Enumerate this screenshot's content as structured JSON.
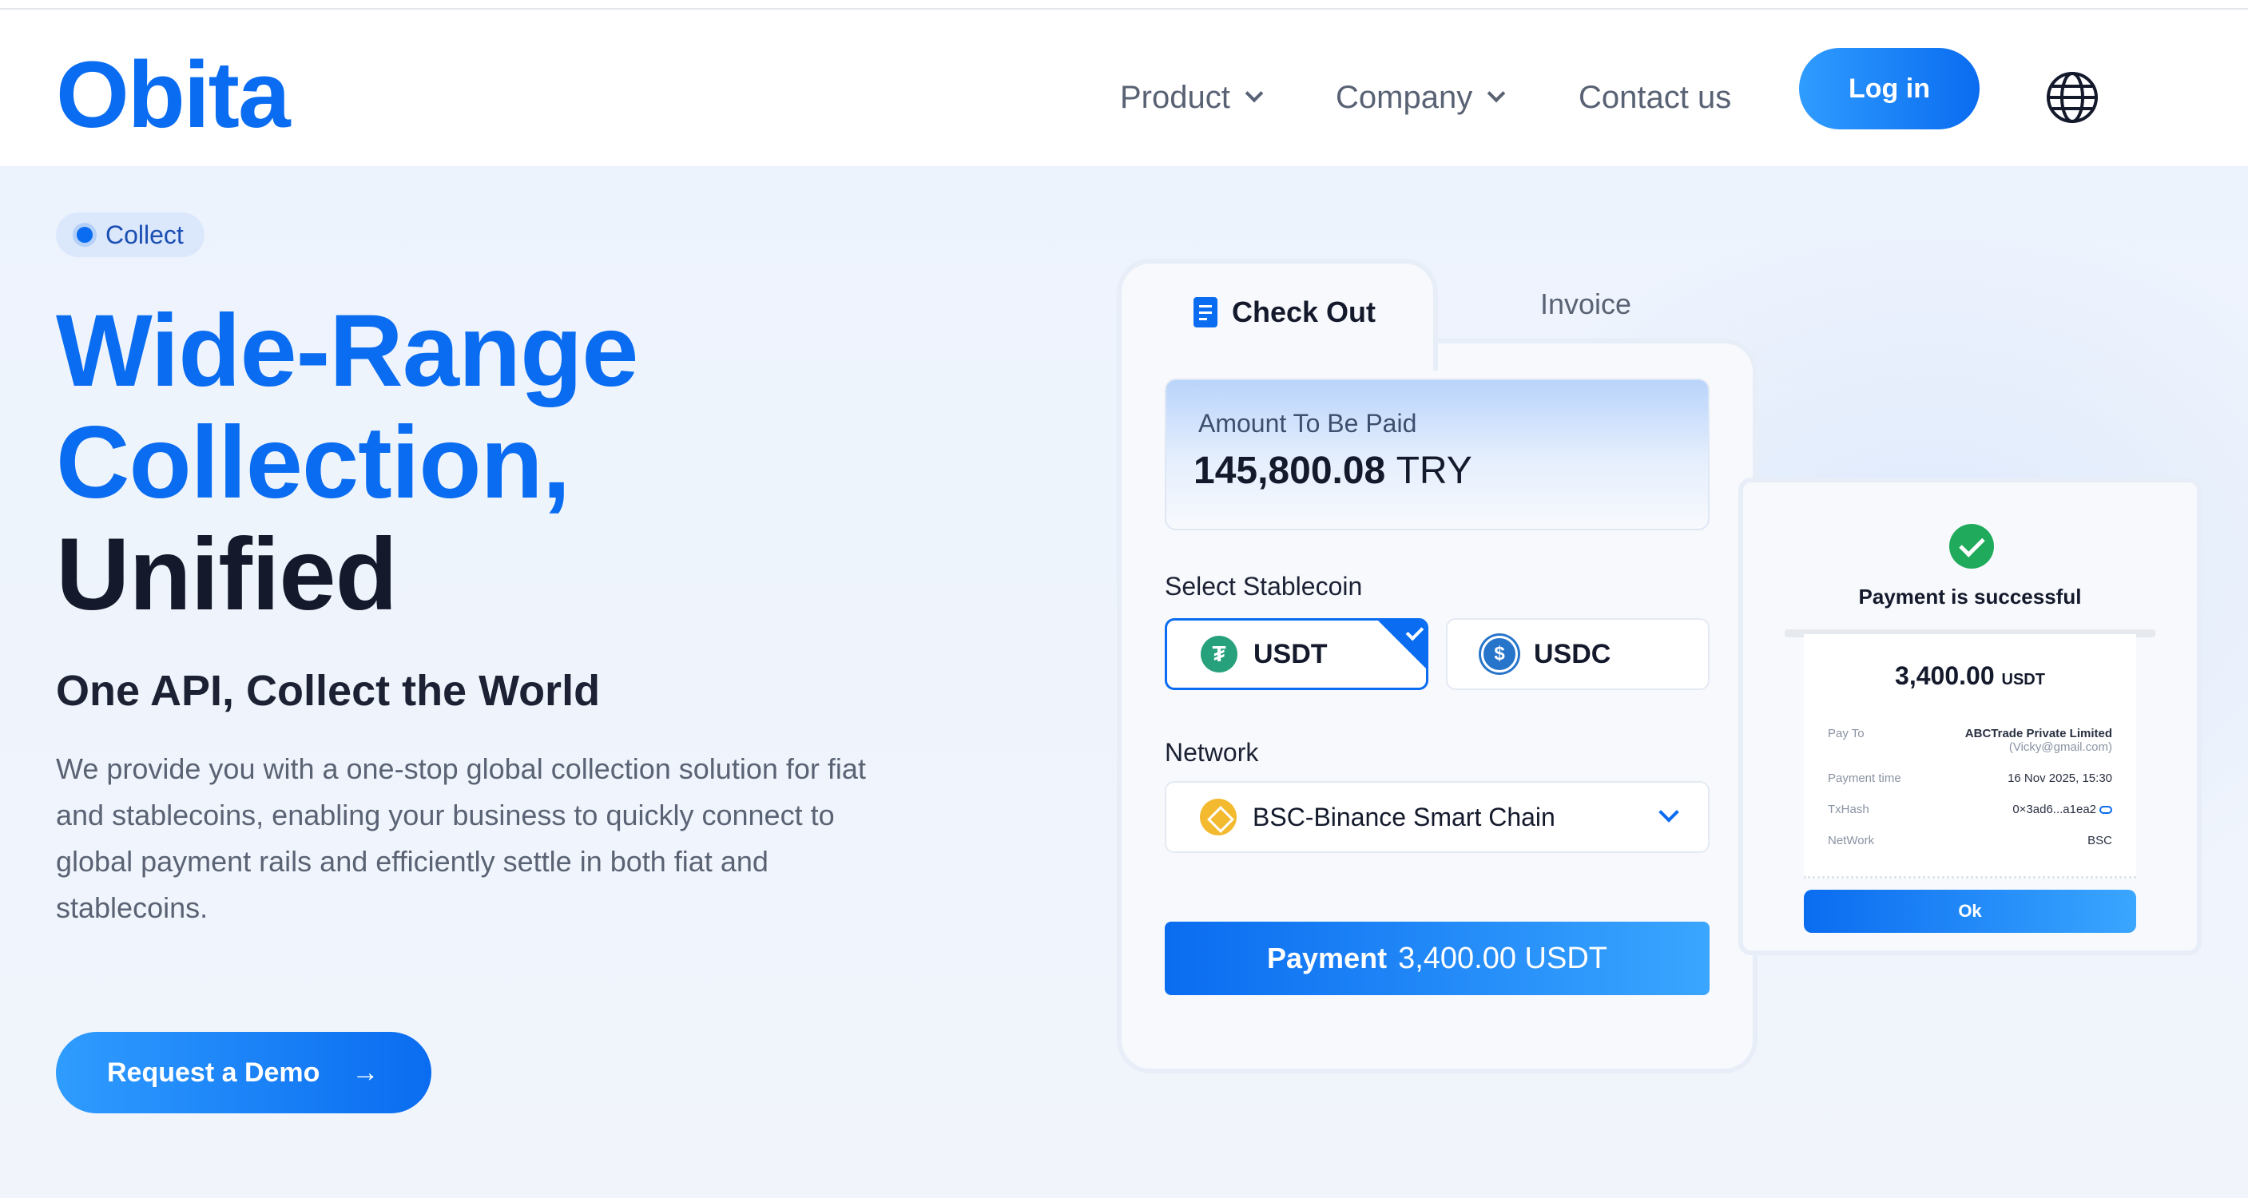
{
  "brand": {
    "logo": "Obita"
  },
  "nav": {
    "items": [
      {
        "label": "Product",
        "has_dropdown": true
      },
      {
        "label": "Company",
        "has_dropdown": true
      },
      {
        "label": "Contact us",
        "has_dropdown": false
      }
    ],
    "login_label": "Log in",
    "language_icon": "globe-icon"
  },
  "hero": {
    "badge": "Collect",
    "headline": [
      "Wide-Range",
      "Collection,",
      "Unified"
    ],
    "subhead": "One API, Collect the World",
    "description": "We provide you with a one-stop global collection solution for fiat and stablecoins, enabling your business to quickly connect to global payment rails and efficiently settle in both fiat and stablecoins.",
    "cta_label": "Request a Demo",
    "cta_arrow": "→"
  },
  "checkout": {
    "tabs": {
      "active": "Check Out",
      "inactive": "Invoice"
    },
    "amount_label": "Amount To Be Paid",
    "amount_value": "145,800.08",
    "amount_currency": "TRY",
    "select_label": "Select Stablecoin",
    "coins": [
      {
        "symbol": "USDT",
        "glyph": "₮",
        "selected": true
      },
      {
        "symbol": "USDC",
        "glyph": "$",
        "selected": false
      }
    ],
    "network_label": "Network",
    "network_value": "BSC-Binance Smart Chain",
    "pay_label": "Payment",
    "pay_amount": "3,400.00 USDT"
  },
  "receipt": {
    "status": "Payment is successful",
    "amount": "3,400.00",
    "currency": "USDT",
    "rows": {
      "pay_to_label": "Pay To",
      "pay_to_name": "ABCTrade Private Limited",
      "pay_to_email": "(Vicky@gmail.com)",
      "time_label": "Payment time",
      "time_value": "16 Nov 2025, 15:30",
      "txhash_label": "TxHash",
      "txhash_value": "0×3ad6...a1ea2",
      "network_label": "NetWork",
      "network_value": "BSC"
    },
    "ok_label": "Ok"
  },
  "colors": {
    "accent": "#0a6cf0",
    "dark": "#141a2c",
    "success": "#1faa5c"
  }
}
